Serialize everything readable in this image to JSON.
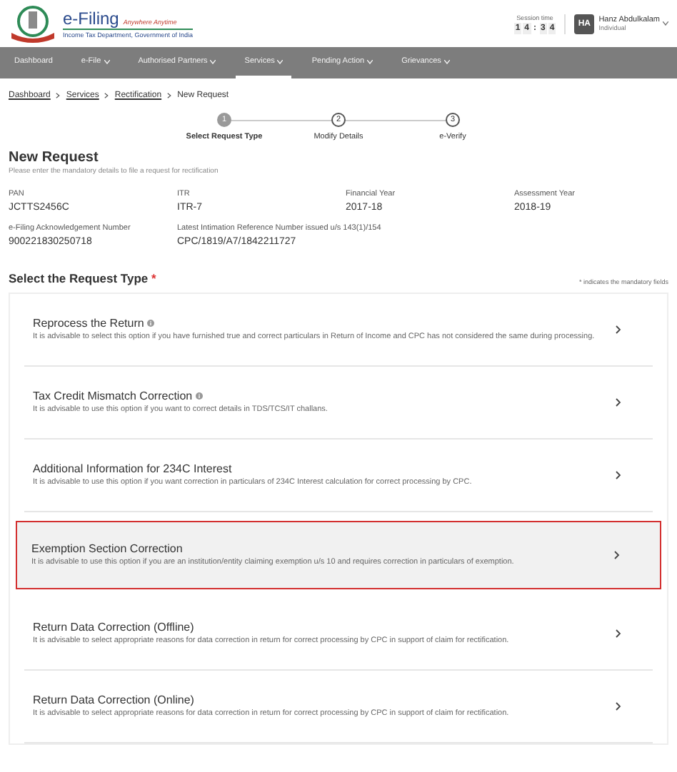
{
  "header": {
    "brand": "e-Filing",
    "tagline": "Anywhere Anytime",
    "department": "Income Tax Department, Government of India",
    "session_label": "Session time",
    "session_digits": [
      "1",
      "4",
      ":",
      "3",
      "4"
    ],
    "user": {
      "initials": "HA",
      "name": "Hanz Abdulkalam",
      "role": "Individual"
    }
  },
  "nav": [
    {
      "label": "Dashboard",
      "dropdown": false,
      "selected": false
    },
    {
      "label": "e-File",
      "dropdown": true,
      "selected": false
    },
    {
      "label": "Authorised Partners",
      "dropdown": true,
      "selected": false
    },
    {
      "label": "Services",
      "dropdown": true,
      "selected": true
    },
    {
      "label": "Pending Action",
      "dropdown": true,
      "selected": false
    },
    {
      "label": "Grievances",
      "dropdown": true,
      "selected": false
    }
  ],
  "breadcrumb": [
    {
      "label": "Dashboard",
      "link": true
    },
    {
      "label": "Services",
      "link": true
    },
    {
      "label": "Rectification",
      "link": true
    },
    {
      "label": "New Request",
      "link": false
    }
  ],
  "steps": [
    {
      "number": "1",
      "label": "Select Request Type",
      "selected": true
    },
    {
      "number": "2",
      "label": "Modify Details",
      "selected": false
    },
    {
      "number": "3",
      "label": "e-Verify",
      "selected": false
    }
  ],
  "title": "New Request",
  "subtitle": "Please enter the mandatory details to file a request for rectification",
  "fields": [
    {
      "label": "PAN",
      "value": "JCTTS2456C"
    },
    {
      "label": "ITR",
      "value": "ITR-7"
    },
    {
      "label": "Financial Year",
      "value": "2017-18"
    },
    {
      "label": "Assessment Year",
      "value": "2018-19"
    },
    {
      "label": "e-Filing Acknowledgement Number",
      "value": "900221830250718"
    },
    {
      "label": "Latest Intimation Reference Number issued u/s 143(1)/154",
      "value": "CPC/1819/A7/1842211727"
    }
  ],
  "request_heading": "Select the Request Type",
  "required_mark": "*",
  "mandatory_note": "* indicates the mandatory fields",
  "options": [
    {
      "title": "Reprocess the Return",
      "info": true,
      "selected": false,
      "description": "It is advisable to select this option if you have furnished true and correct particulars in Return of Income and CPC has not considered the same during processing."
    },
    {
      "title": "Tax Credit Mismatch Correction",
      "info": true,
      "selected": false,
      "description": "It is advisable to use this option if you want to correct details in TDS/TCS/IT challans."
    },
    {
      "title": "Additional Information for 234C Interest",
      "info": false,
      "selected": false,
      "description": "It is advisable to use this option if you want correction in particulars of 234C Interest calculation for correct processing by CPC."
    },
    {
      "title": "Exemption Section Correction",
      "info": false,
      "selected": true,
      "description": "It is advisable to use this option if you are an institution/entity claiming exemption u/s 10 and requires correction in particulars of exemption."
    },
    {
      "title": "Return Data Correction (Offline)",
      "info": false,
      "selected": false,
      "description": "It is advisable to select appropriate reasons for data correction in return for correct processing by CPC in support of claim for rectification."
    },
    {
      "title": "Return Data Correction (Online)",
      "info": false,
      "selected": false,
      "description": "It is advisable to select appropriate reasons for data correction in return for correct processing by CPC in support of claim for rectification."
    }
  ]
}
